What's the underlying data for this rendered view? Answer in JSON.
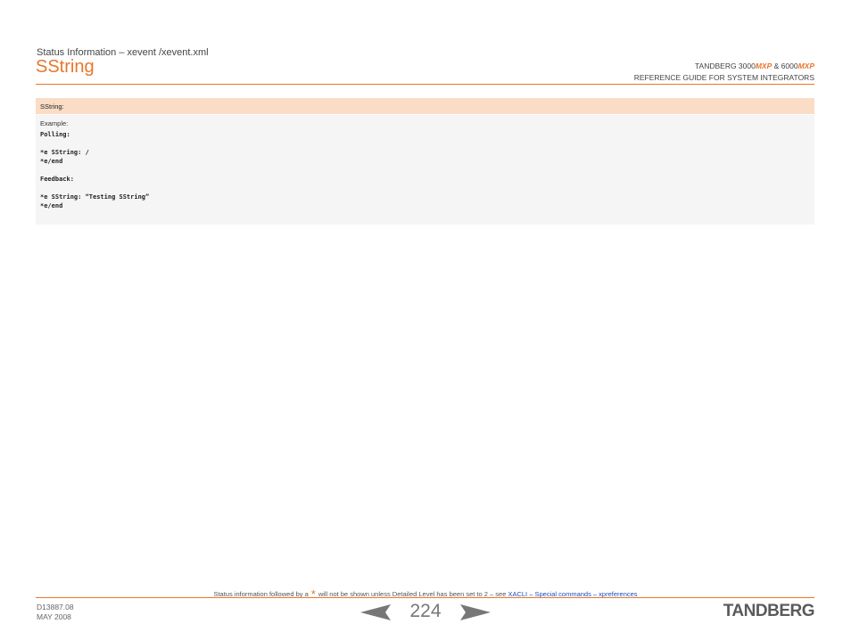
{
  "header": {
    "section": "Status Information – xevent /xevent.xml",
    "title": "SString",
    "brand_line1_a": "TANDBERG 3000",
    "brand_mxp": "MXP",
    "brand_line1_b": " & 6000",
    "brand_line2": "REFERENCE GUIDE FOR SYSTEM INTEGRATORS"
  },
  "table": {
    "heading": "SString:",
    "example_label": "Example:",
    "polling_label": "Polling:",
    "polling_lines": [
      "*e SString: /",
      "*e/end"
    ],
    "feedback_label": "Feedback:",
    "feedback_lines": [
      "*e SString: “Testing SString”",
      "*e/end"
    ]
  },
  "footer": {
    "note_before": "Status information followed by a",
    "star": "*",
    "note_after": "will not be shown unless Detailed Level has been set to 2 – see",
    "link_text": "XACLI – Special commands – xpreferences",
    "doc_id": "D13887.08",
    "date": "MAY 2008",
    "page_number": "224",
    "logo": "TANDBERG"
  },
  "colors": {
    "accent": "#e8762b",
    "table_header_bg": "#fbdcc4",
    "table_body_bg": "#f5f5f5",
    "link": "#1a4fc0"
  }
}
